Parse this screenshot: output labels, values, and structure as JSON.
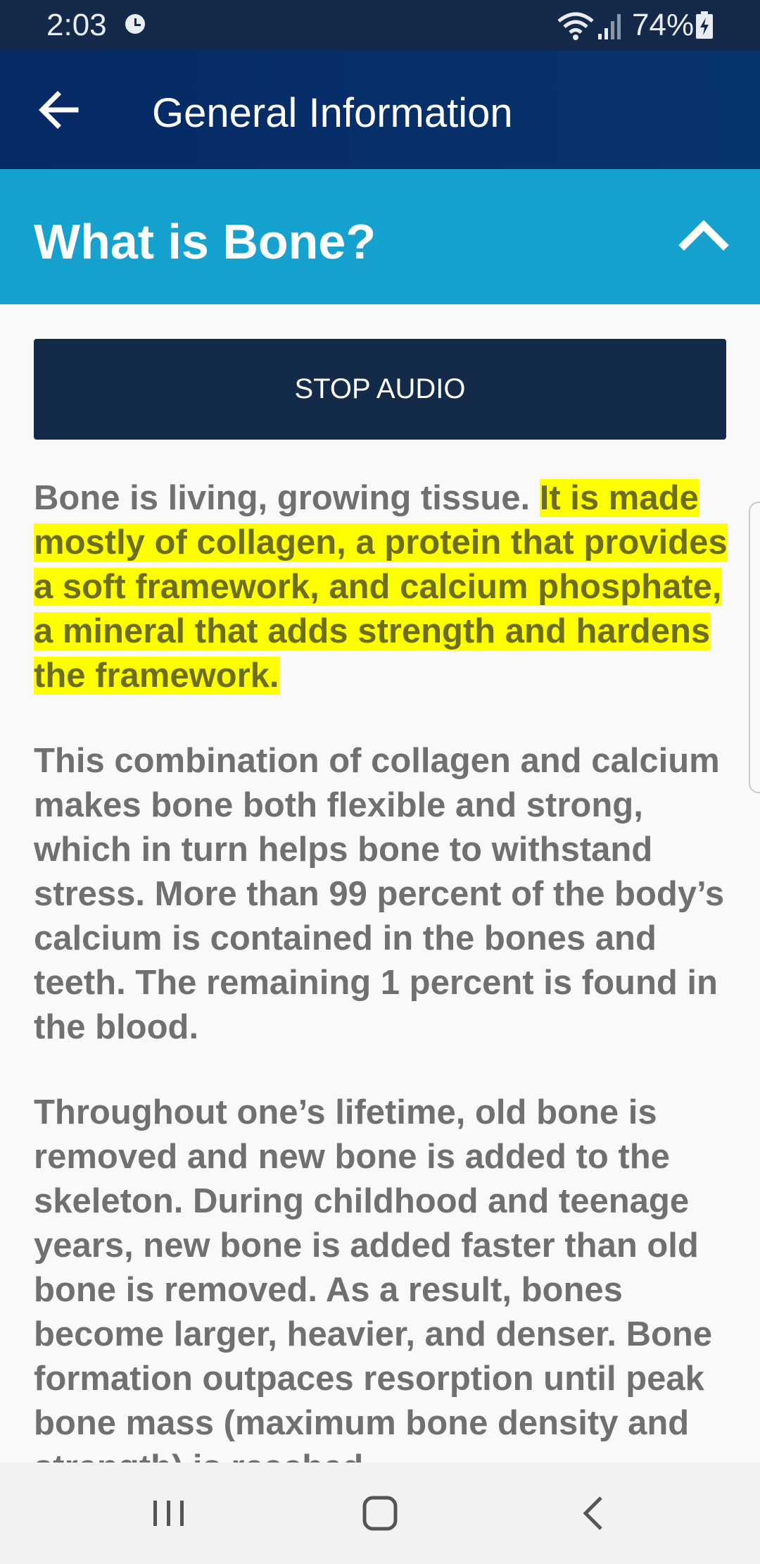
{
  "status_bar": {
    "time": "2:03",
    "battery": "74%"
  },
  "app_bar": {
    "title": "General Information",
    "back_icon": "arrow-left-icon"
  },
  "section": {
    "title": "What is Bone?",
    "toggle_icon": "chevron-up-icon"
  },
  "audio_button": {
    "label": "STOP AUDIO"
  },
  "content": {
    "p1_plain": "Bone is living, growing tissue. ",
    "p1_highlight": "It is made mostly of collagen, a protein that provides a soft framework, and calcium phosphate, a mineral that adds strength and hardens the framework.",
    "p2": "This combination of collagen and calcium makes bone both flexible and strong, which in turn helps bone to withstand stress. More than 99 percent of the body’s calcium is contained in the bones and teeth. The remaining 1 percent is found in the blood.",
    "p3": "Throughout one’s lifetime, old bone is removed and new bone is added to the skeleton. During childhood and teenage years, new bone is added faster than old bone is removed. As a result, bones become larger, heavier, and denser. Bone formation outpaces resorption until peak bone mass (maximum bone density and strength) is reached."
  },
  "colors": {
    "status_bar": "#152a4a",
    "app_bar": "#062a66",
    "section_header": "#15a2cf",
    "button": "#142a49",
    "highlight": "#ffff00"
  },
  "nav_bar": {
    "recents_icon": "recents-icon",
    "home_icon": "home-icon",
    "back_icon": "back-chevron-icon"
  }
}
